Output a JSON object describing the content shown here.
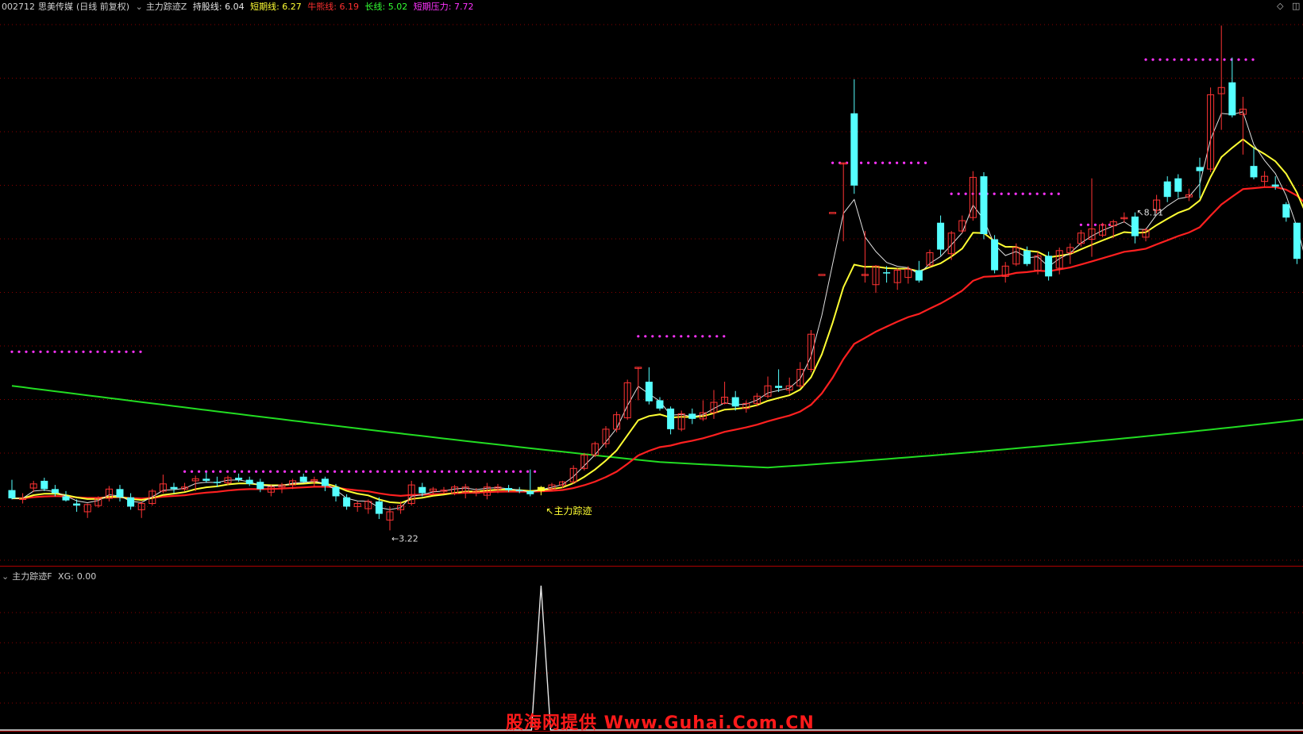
{
  "header": {
    "code": "002712",
    "name": "思美传媒",
    "period": "(日线 前复权)",
    "indicator": "主力踪迹Z",
    "fields": [
      {
        "label": "持股线:",
        "value": "6.04",
        "color": "#e8e8e8"
      },
      {
        "label": "短期线:",
        "value": "6.27",
        "color": "#ffff33"
      },
      {
        "label": "牛熊线:",
        "value": "6.19",
        "color": "#ff3030"
      },
      {
        "label": "长线:",
        "value": "5.02",
        "color": "#33ff33"
      },
      {
        "label": "短期压力:",
        "value": "7.72",
        "color": "#ff33ff"
      }
    ]
  },
  "sub_header": {
    "indicator": "主力踪迹F",
    "label": "XG:",
    "value": "0.00"
  },
  "controls": {
    "diamond": "◇",
    "window": "◫"
  },
  "watermark": "股海网提供 Www.Guhai.Com.CN",
  "colors": {
    "up": "#ff3333",
    "down": "#55ffff",
    "hold": "#e0e0e0",
    "short": "#ffff33",
    "bull": "#ff2020",
    "long": "#22dd22",
    "pressure": "#ff33ff",
    "grid": "#8b0000"
  },
  "chart_data": {
    "type": "candlestick",
    "price_range": [
      2.9,
      8.25
    ],
    "annotations": [
      {
        "text": "8.11",
        "index": 104,
        "kind": "high"
      },
      {
        "text": "3.22",
        "index": 35,
        "kind": "low"
      },
      {
        "text": "主力踪迹",
        "index": 49,
        "kind": "signal"
      }
    ],
    "candles": [
      [
        3.61,
        3.71,
        3.52,
        3.53
      ],
      [
        3.52,
        3.58,
        3.48,
        3.53
      ],
      [
        3.63,
        3.7,
        3.59,
        3.67
      ],
      [
        3.7,
        3.73,
        3.6,
        3.62
      ],
      [
        3.62,
        3.66,
        3.55,
        3.58
      ],
      [
        3.55,
        3.6,
        3.5,
        3.51
      ],
      [
        3.48,
        3.52,
        3.4,
        3.46
      ],
      [
        3.4,
        3.48,
        3.34,
        3.47
      ],
      [
        3.46,
        3.55,
        3.44,
        3.53
      ],
      [
        3.53,
        3.65,
        3.5,
        3.62
      ],
      [
        3.62,
        3.66,
        3.5,
        3.54
      ],
      [
        3.54,
        3.58,
        3.42,
        3.45
      ],
      [
        3.42,
        3.5,
        3.34,
        3.48
      ],
      [
        3.48,
        3.62,
        3.46,
        3.6
      ],
      [
        3.6,
        3.76,
        3.58,
        3.67
      ],
      [
        3.64,
        3.68,
        3.58,
        3.62
      ],
      [
        3.62,
        3.68,
        3.6,
        3.64
      ],
      [
        3.7,
        3.75,
        3.6,
        3.72
      ],
      [
        3.72,
        3.78,
        3.68,
        3.7
      ],
      [
        3.69,
        3.74,
        3.64,
        3.68
      ],
      [
        3.68,
        3.75,
        3.66,
        3.73
      ],
      [
        3.73,
        3.77,
        3.69,
        3.71
      ],
      [
        3.71,
        3.74,
        3.65,
        3.67
      ],
      [
        3.69,
        3.72,
        3.59,
        3.62
      ],
      [
        3.59,
        3.66,
        3.55,
        3.64
      ],
      [
        3.64,
        3.68,
        3.58,
        3.66
      ],
      [
        3.66,
        3.72,
        3.62,
        3.7
      ],
      [
        3.74,
        3.77,
        3.68,
        3.69
      ],
      [
        3.7,
        3.74,
        3.64,
        3.71
      ],
      [
        3.72,
        3.74,
        3.6,
        3.65
      ],
      [
        3.64,
        3.67,
        3.5,
        3.55
      ],
      [
        3.54,
        3.57,
        3.42,
        3.45
      ],
      [
        3.45,
        3.5,
        3.4,
        3.48
      ],
      [
        3.43,
        3.52,
        3.38,
        3.5
      ],
      [
        3.5,
        3.54,
        3.33,
        3.38
      ],
      [
        3.32,
        3.45,
        3.22,
        3.4
      ],
      [
        3.42,
        3.5,
        3.38,
        3.46
      ],
      [
        3.48,
        3.7,
        3.46,
        3.66
      ],
      [
        3.64,
        3.68,
        3.55,
        3.58
      ],
      [
        3.6,
        3.64,
        3.56,
        3.62
      ],
      [
        3.61,
        3.64,
        3.58,
        3.61
      ],
      [
        3.58,
        3.66,
        3.56,
        3.64
      ],
      [
        3.59,
        3.67,
        3.53,
        3.64
      ],
      [
        3.58,
        3.63,
        3.55,
        3.6
      ],
      [
        3.56,
        3.68,
        3.52,
        3.64
      ],
      [
        3.62,
        3.67,
        3.58,
        3.64
      ],
      [
        3.63,
        3.66,
        3.59,
        3.61
      ],
      [
        3.61,
        3.64,
        3.58,
        3.6
      ],
      [
        3.6,
        3.81,
        3.55,
        3.57
      ],
      [
        3.6,
        3.65,
        3.56,
        3.64
      ],
      [
        3.62,
        3.68,
        3.6,
        3.66
      ],
      [
        3.66,
        3.7,
        3.63,
        3.69
      ],
      [
        3.69,
        3.85,
        3.67,
        3.82
      ],
      [
        3.82,
        3.97,
        3.8,
        3.95
      ],
      [
        3.95,
        4.08,
        3.93,
        4.06
      ],
      [
        4.06,
        4.23,
        4.02,
        4.2
      ],
      [
        4.2,
        4.37,
        4.17,
        4.34
      ],
      [
        4.31,
        4.68,
        4.29,
        4.65
      ],
      [
        4.8,
        4.8,
        4.48,
        4.8
      ],
      [
        4.66,
        4.8,
        4.44,
        4.47
      ],
      [
        4.48,
        4.51,
        4.38,
        4.4
      ],
      [
        4.4,
        4.42,
        4.15,
        4.2
      ],
      [
        4.2,
        4.38,
        4.18,
        4.35
      ],
      [
        4.35,
        4.4,
        4.25,
        4.3
      ],
      [
        4.3,
        4.48,
        4.28,
        4.36
      ],
      [
        4.36,
        4.58,
        4.3,
        4.46
      ],
      [
        4.45,
        4.66,
        4.44,
        4.51
      ],
      [
        4.51,
        4.57,
        4.38,
        4.42
      ],
      [
        4.4,
        4.48,
        4.36,
        4.45
      ],
      [
        4.45,
        4.55,
        4.42,
        4.52
      ],
      [
        4.52,
        4.71,
        4.5,
        4.62
      ],
      [
        4.62,
        4.78,
        4.56,
        4.6
      ],
      [
        4.58,
        4.7,
        4.54,
        4.62
      ],
      [
        4.62,
        4.85,
        4.6,
        4.78
      ],
      [
        4.78,
        5.16,
        4.75,
        5.12
      ],
      [
        5.7,
        5.7,
        5.7,
        5.7
      ],
      [
        6.3,
        6.3,
        6.3,
        6.3
      ],
      [
        6.78,
        6.78,
        6.02,
        6.78
      ],
      [
        7.26,
        7.59,
        6.48,
        6.56
      ],
      [
        5.7,
        6.12,
        5.62,
        5.7
      ],
      [
        5.6,
        5.79,
        5.52,
        5.78
      ],
      [
        5.72,
        5.78,
        5.62,
        5.71
      ],
      [
        5.62,
        5.76,
        5.55,
        5.74
      ],
      [
        5.67,
        5.78,
        5.61,
        5.75
      ],
      [
        5.74,
        5.83,
        5.62,
        5.64
      ],
      [
        5.79,
        5.94,
        5.77,
        5.91
      ],
      [
        6.2,
        6.27,
        5.88,
        5.94
      ],
      [
        5.9,
        6.12,
        5.84,
        6.1
      ],
      [
        6.12,
        6.27,
        6.1,
        6.22
      ],
      [
        6.25,
        6.7,
        6.22,
        6.64
      ],
      [
        6.65,
        6.69,
        6.04,
        6.09
      ],
      [
        6.04,
        6.08,
        5.71,
        5.74
      ],
      [
        5.68,
        5.82,
        5.62,
        5.78
      ],
      [
        5.8,
        6.0,
        5.78,
        5.96
      ],
      [
        5.93,
        5.97,
        5.78,
        5.8
      ],
      [
        5.74,
        5.92,
        5.7,
        5.88
      ],
      [
        5.88,
        5.92,
        5.64,
        5.68
      ],
      [
        5.76,
        5.96,
        5.7,
        5.93
      ],
      [
        5.91,
        6.0,
        5.8,
        5.96
      ],
      [
        6.0,
        6.13,
        5.97,
        6.1
      ],
      [
        6.04,
        6.63,
        5.87,
        6.14
      ],
      [
        6.08,
        6.2,
        6.06,
        6.18
      ],
      [
        6.17,
        6.23,
        6.05,
        6.21
      ],
      [
        6.24,
        6.3,
        6.2,
        6.25
      ],
      [
        6.26,
        6.3,
        6.0,
        6.07
      ],
      [
        6.06,
        6.15,
        6.02,
        6.13
      ],
      [
        6.32,
        6.47,
        6.29,
        6.42
      ],
      [
        6.6,
        6.65,
        6.4,
        6.45
      ],
      [
        6.63,
        6.67,
        6.44,
        6.5
      ],
      [
        6.45,
        6.53,
        6.41,
        6.47
      ],
      [
        6.74,
        6.83,
        6.44,
        6.7
      ],
      [
        6.72,
        7.51,
        6.69,
        7.44
      ],
      [
        7.45,
        8.11,
        7.1,
        7.51
      ],
      [
        7.56,
        7.8,
        7.22,
        7.24
      ],
      [
        7.25,
        7.42,
        6.86,
        7.3
      ],
      [
        6.75,
        6.93,
        6.62,
        6.64
      ],
      [
        6.6,
        6.7,
        6.55,
        6.65
      ],
      [
        6.57,
        6.65,
        6.52,
        6.55
      ],
      [
        6.38,
        6.4,
        6.21,
        6.25
      ],
      [
        6.2,
        6.2,
        5.8,
        5.85
      ],
      [
        5.8,
        5.8,
        5.3,
        5.39
      ],
      [
        5.38,
        5.38,
        5.22,
        5.22
      ]
    ],
    "signal_index": 49,
    "sub_series": {
      "name": "XG",
      "signal_index": 49,
      "peak": 1.0
    }
  }
}
